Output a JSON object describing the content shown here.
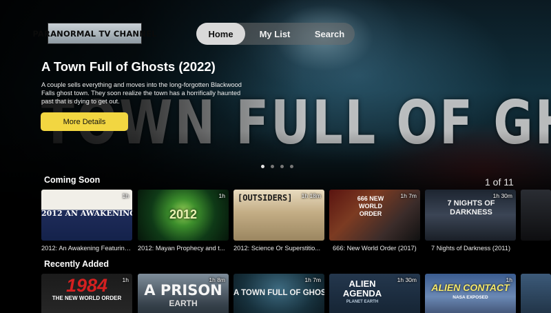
{
  "app": {
    "logo_text": "PARANORMAL TV CHANNEL"
  },
  "nav": {
    "tabs": [
      {
        "label": "Home",
        "active": true
      },
      {
        "label": "My List",
        "active": false
      },
      {
        "label": "Search",
        "active": false
      }
    ]
  },
  "hero": {
    "title": "A Town Full of Ghosts (2022)",
    "description": "A couple sells everything and moves into the long-forgotten Blackwood Falls ghost town. They soon realize the town has a horrifically haunted past that is dying to get out.",
    "art_text": "TOWN FULL OF GHOSTS",
    "button_label": "More Details",
    "carousel_dots": 4,
    "carousel_active": 1
  },
  "coming_soon": {
    "title": "Coming Soon",
    "counter": "1 of 11",
    "items": [
      {
        "title": "2012: An Awakening Featuring...",
        "duration": "1h",
        "art_text": "2012 AN AWAKENING"
      },
      {
        "title": "2012: Mayan Prophecy and t...",
        "duration": "1h",
        "art_text": "2012"
      },
      {
        "title": "2012: Science Or Superstitio...",
        "duration": "1h 18m",
        "art_text": "[OUTSIDERS]"
      },
      {
        "title": "666: New World Order (2017)",
        "duration": "1h 7m",
        "art_text": "666 NEW WORLD ORDER"
      },
      {
        "title": "7 Nights of Darkness (2011)",
        "duration": "1h 30m",
        "art_text": "7 NIGHTS OF DARKNESS"
      },
      {
        "title": "",
        "duration": "",
        "art_text": ""
      }
    ]
  },
  "recently_added": {
    "title": "Recently Added",
    "items": [
      {
        "duration": "1h",
        "art_text": "1984",
        "art_subtext": "THE NEW WORLD ORDER"
      },
      {
        "duration": "1h 8m",
        "art_text": "A PRISON",
        "art_subtext": "EARTH"
      },
      {
        "duration": "1h 7m",
        "art_text": "A TOWN FULL OF GHOSTS",
        "art_subtext": ""
      },
      {
        "duration": "1h 30m",
        "art_text": "ALIEN AGENDA",
        "art_subtext": "PLANET EARTH"
      },
      {
        "duration": "1h",
        "art_text": "ALIEN CONTACT",
        "art_subtext": "NASA EXPOSED"
      },
      {
        "duration": "",
        "art_text": "",
        "art_subtext": ""
      }
    ]
  },
  "colors": {
    "accent_button": "#f2d641",
    "nav_active_bg": "#d9d9d9",
    "background": "#000000"
  }
}
